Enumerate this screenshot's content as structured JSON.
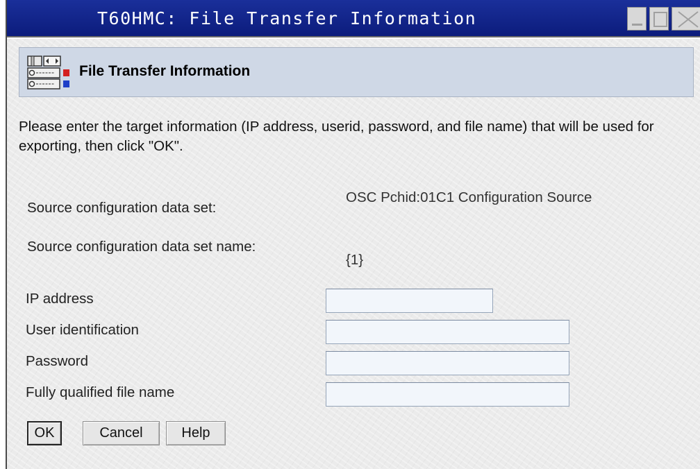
{
  "window": {
    "title": "T60HMC: File Transfer Information"
  },
  "header": {
    "title": "File Transfer Information",
    "icon": "hardware-config-icon"
  },
  "instructions": "Please enter the target information (IP address, userid, password, and file name) that will be used for exporting, then click \"OK\".",
  "source": {
    "dataset_label": "Source configuration data set:",
    "dataset_value": "OSC Pchid:01C1 Configuration Source",
    "dataset_name_label": "Source configuration data set name:",
    "dataset_name_value": "{1}"
  },
  "fields": {
    "ip_label": "IP address",
    "ip_value": "",
    "userid_label": "User identification",
    "userid_value": "",
    "password_label": "Password",
    "password_value": "",
    "filename_label": "Fully qualified file name",
    "filename_value": ""
  },
  "buttons": {
    "ok": "OK",
    "cancel": "Cancel",
    "help": "Help"
  },
  "colors": {
    "titlebar": "#0c1c7c",
    "header_panel": "#cfd8e6",
    "field_bg": "#f2f6fb"
  }
}
